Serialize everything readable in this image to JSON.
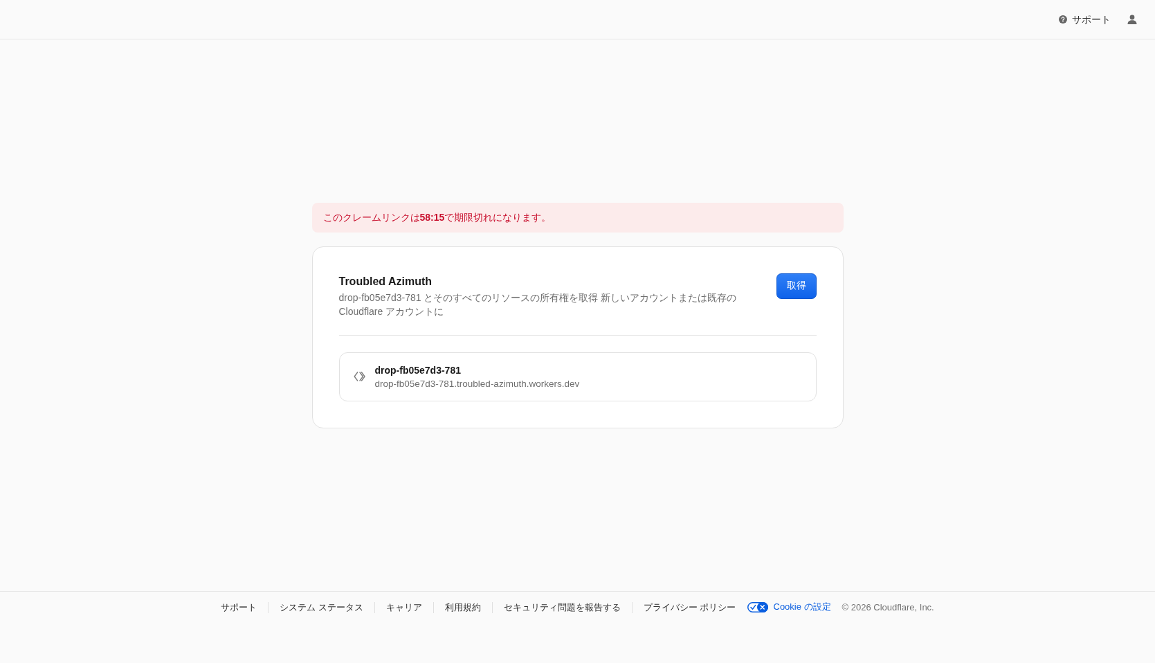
{
  "header": {
    "support_link": "サポート"
  },
  "banner": {
    "message": "このクレームリンクは**58:15**で期限切れになります。"
  },
  "card": {
    "title": "Troubled Azimuth",
    "description": "drop-fb05e7d3-781 とそのすべてのリソースの所有権を取得 新しいアカウントまたは既存の Cloudflare アカウントに",
    "claim_button": "取得",
    "resources": [
      {
        "name": "drop-fb05e7d3-781",
        "url": "drop-fb05e7d3-781.troubled-azimuth.workers.dev"
      }
    ]
  },
  "footer": {
    "links": [
      "サポート",
      "システム ステータス",
      "キャリア",
      "利用規約",
      "セキュリティ問題を報告する",
      "プライバシー ポリシー"
    ],
    "cookie_settings": "Cookie の設定",
    "copyright": "© 2026 Cloudflare, Inc."
  }
}
